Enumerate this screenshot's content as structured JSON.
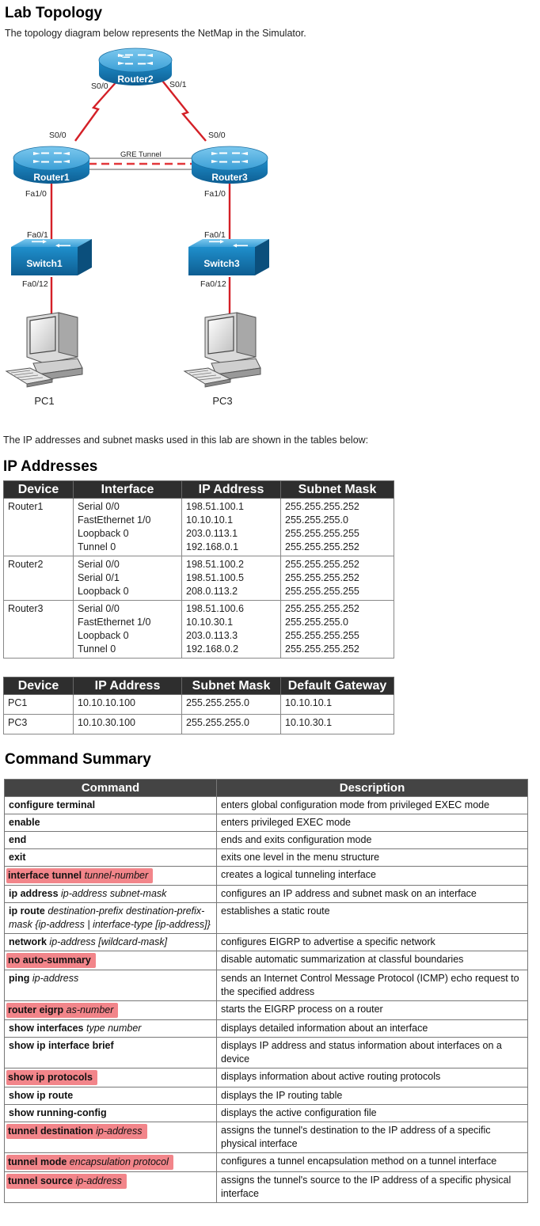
{
  "lab_topology": {
    "heading": "Lab Topology",
    "intro": "The topology diagram below represents the NetMap in the Simulator."
  },
  "diagram": {
    "router2": {
      "name": "Router2",
      "left_port": "S0/0",
      "right_port": "S0/1"
    },
    "router1": {
      "name": "Router1",
      "serial_port": "S0/0",
      "fa_port": "Fa1/0"
    },
    "router3": {
      "name": "Router3",
      "serial_port": "S0/0",
      "fa_port": "Fa1/0"
    },
    "tunnel_label": "GRE Tunnel",
    "switch1": {
      "name": "Switch1",
      "up_port": "Fa0/1",
      "down_port": "Fa0/12"
    },
    "switch3": {
      "name": "Switch3",
      "up_port": "Fa0/1",
      "down_port": "Fa0/12"
    },
    "pc1": "PC1",
    "pc3": "PC3",
    "colors": {
      "router_body": "#1d86c4",
      "router_top": "#4fb3e3",
      "link": "#d42027",
      "tunnel": "#e2373a"
    }
  },
  "tables_intro": "The IP addresses and subnet masks used in this lab are shown in the tables below:",
  "ip_heading": "IP Addresses",
  "routers_table": {
    "headers": [
      "Device",
      "Interface",
      "IP Address",
      "Subnet Mask"
    ],
    "rows": [
      {
        "device": "Router1",
        "interfaces": [
          "Serial 0/0",
          "FastEthernet 1/0",
          "Loopback 0",
          "Tunnel 0"
        ],
        "ips": [
          "198.51.100.1",
          "10.10.10.1",
          "203.0.113.1",
          "192.168.0.1"
        ],
        "masks": [
          "255.255.255.252",
          "255.255.255.0",
          "255.255.255.255",
          "255.255.255.252"
        ]
      },
      {
        "device": "Router2",
        "interfaces": [
          "Serial 0/0",
          "Serial 0/1",
          "Loopback 0"
        ],
        "ips": [
          "198.51.100.2",
          "198.51.100.5",
          "208.0.113.2"
        ],
        "masks": [
          "255.255.255.252",
          "255.255.255.252",
          "255.255.255.255"
        ]
      },
      {
        "device": "Router3",
        "interfaces": [
          "Serial 0/0",
          "FastEthernet 1/0",
          "Loopback 0",
          "Tunnel 0"
        ],
        "ips": [
          "198.51.100.6",
          "10.10.30.1",
          "203.0.113.3",
          "192.168.0.2"
        ],
        "masks": [
          "255.255.255.252",
          "255.255.255.0",
          "255.255.255.255",
          "255.255.255.252"
        ]
      }
    ]
  },
  "pcs_table": {
    "headers": [
      "Device",
      "IP Address",
      "Subnet Mask",
      "Default Gateway"
    ],
    "rows": [
      {
        "device": "PC1",
        "ip": "10.10.10.100",
        "mask": "255.255.255.0",
        "gateway": "10.10.10.1"
      },
      {
        "device": "PC3",
        "ip": "10.10.30.100",
        "mask": "255.255.255.0",
        "gateway": "10.10.30.1"
      }
    ]
  },
  "command_heading": "Command Summary",
  "command_table": {
    "headers": [
      "Command",
      "Description"
    ],
    "rows": [
      {
        "cmd": "configure terminal",
        "arg": "",
        "desc": "enters global configuration mode from privileged EXEC mode",
        "highlight": false
      },
      {
        "cmd": "enable",
        "arg": "",
        "desc": "enters privileged EXEC mode",
        "highlight": false
      },
      {
        "cmd": "end",
        "arg": "",
        "desc": "ends and exits configuration mode",
        "highlight": false
      },
      {
        "cmd": "exit",
        "arg": "",
        "desc": "exits one level in the menu structure",
        "highlight": false
      },
      {
        "cmd": "interface tunnel",
        "arg": "tunnel-number",
        "desc": "creates a logical tunneling interface",
        "highlight": true
      },
      {
        "cmd": "ip address",
        "arg": "ip-address subnet-mask",
        "desc": "configures an IP address and subnet mask on an interface",
        "highlight": false
      },
      {
        "cmd": "ip route",
        "arg": "destination-prefix destination-prefix-mask {ip-address | interface-type [ip-address]}",
        "desc": "establishes a static route",
        "highlight": false
      },
      {
        "cmd": "network",
        "arg": "ip-address [wildcard-mask]",
        "desc": "configures EIGRP to advertise a specific network",
        "highlight": false
      },
      {
        "cmd": "no auto-summary",
        "arg": "",
        "desc": "disable automatic summarization at classful boundaries",
        "highlight": true
      },
      {
        "cmd": "ping",
        "arg": "ip-address",
        "desc": "sends an Internet Control Message Protocol (ICMP) echo request to the specified address",
        "highlight": false
      },
      {
        "cmd": "router eigrp",
        "arg": "as-number",
        "desc": "starts the EIGRP process on a router",
        "highlight": true
      },
      {
        "cmd": "show interfaces",
        "arg": "type number",
        "desc": "displays detailed information about an interface",
        "highlight": false
      },
      {
        "cmd": "show ip interface brief",
        "arg": "",
        "desc": "displays IP address and status information about interfaces on a device",
        "highlight": false
      },
      {
        "cmd": "show ip protocols",
        "arg": "",
        "desc": "displays information about active routing protocols",
        "highlight": true
      },
      {
        "cmd": "show ip route",
        "arg": "",
        "desc": "displays the IP routing table",
        "highlight": false
      },
      {
        "cmd": "show running-config",
        "arg": "",
        "desc": "displays the active configuration file",
        "highlight": false
      },
      {
        "cmd": "tunnel destination",
        "arg": "ip-address",
        "desc": "assigns the tunnel's destination to the IP address of a specific physical interface",
        "highlight": true
      },
      {
        "cmd": "tunnel mode",
        "arg": "encapsulation protocol",
        "desc": "configures a tunnel encapsulation method on a tunnel interface",
        "highlight": true
      },
      {
        "cmd": "tunnel source",
        "arg": "ip-address",
        "desc": "assigns the tunnel's source to the IP address of a specific physical interface",
        "highlight": true
      }
    ]
  }
}
